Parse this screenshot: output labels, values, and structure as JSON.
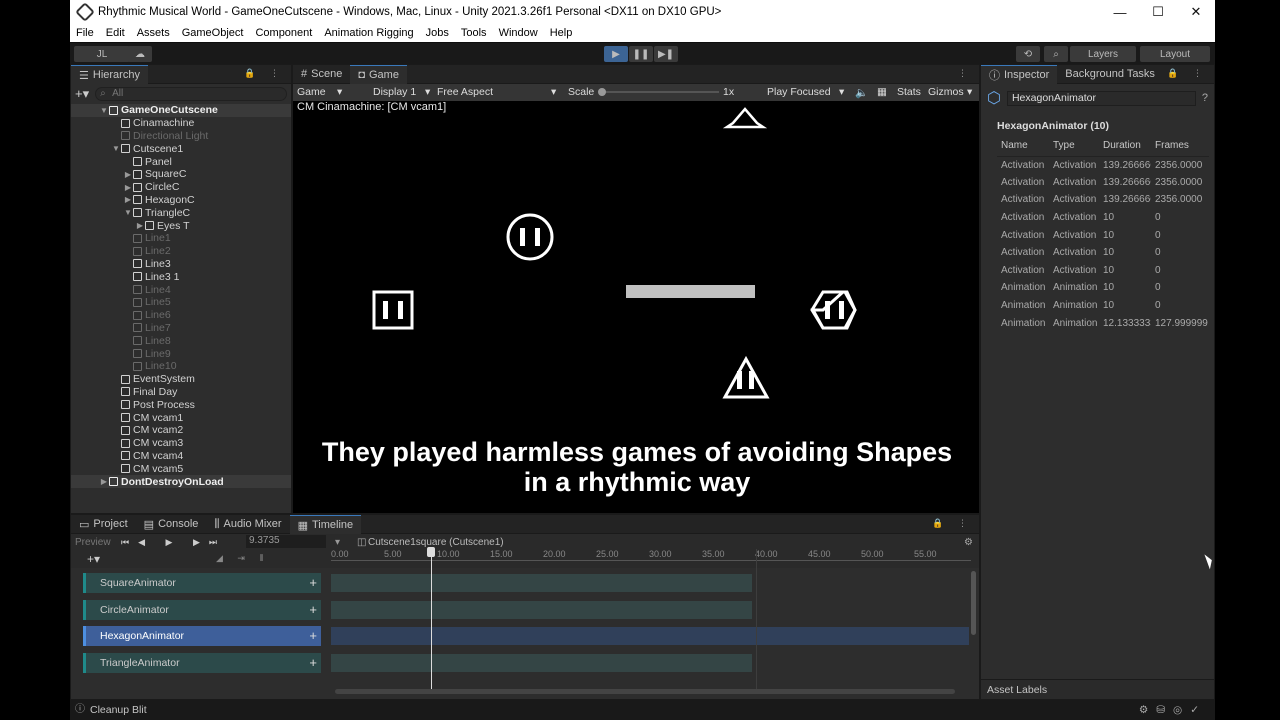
{
  "window": {
    "title": "Rhythmic Musical World - GameOneCutscene - Windows, Mac, Linux - Unity 2021.3.26f1 Personal <DX11 on DX10 GPU>",
    "minimize": "—",
    "maximize": "☐",
    "close": "✕"
  },
  "menu": [
    "File",
    "Edit",
    "Assets",
    "GameObject",
    "Component",
    "Animation Rigging",
    "Jobs",
    "Tools",
    "Window",
    "Help"
  ],
  "toolbar": {
    "account": "JL",
    "layers": "Layers",
    "layout": "Layout"
  },
  "hierarchy": {
    "tab": "Hierarchy",
    "search_placeholder": "All",
    "rows": [
      {
        "label": "GameOneCutscene",
        "depth": 0,
        "arrow": "▼",
        "scene": true
      },
      {
        "label": "Cinamachine",
        "depth": 1,
        "arrow": ""
      },
      {
        "label": "Directional Light",
        "depth": 1,
        "arrow": "",
        "dim": true
      },
      {
        "label": "Cutscene1",
        "depth": 1,
        "arrow": "▼"
      },
      {
        "label": "Panel",
        "depth": 2,
        "arrow": ""
      },
      {
        "label": "SquareC",
        "depth": 2,
        "arrow": "▶"
      },
      {
        "label": "CircleC",
        "depth": 2,
        "arrow": "▶"
      },
      {
        "label": "HexagonC",
        "depth": 2,
        "arrow": "▶"
      },
      {
        "label": "TriangleC",
        "depth": 2,
        "arrow": "▼"
      },
      {
        "label": "Eyes T",
        "depth": 3,
        "arrow": "▶"
      },
      {
        "label": "Line1",
        "depth": 2,
        "arrow": "",
        "dim": true
      },
      {
        "label": "Line2",
        "depth": 2,
        "arrow": "",
        "dim": true
      },
      {
        "label": "Line3",
        "depth": 2,
        "arrow": ""
      },
      {
        "label": "Line3 1",
        "depth": 2,
        "arrow": ""
      },
      {
        "label": "Line4",
        "depth": 2,
        "arrow": "",
        "dim": true
      },
      {
        "label": "Line5",
        "depth": 2,
        "arrow": "",
        "dim": true
      },
      {
        "label": "Line6",
        "depth": 2,
        "arrow": "",
        "dim": true
      },
      {
        "label": "Line7",
        "depth": 2,
        "arrow": "",
        "dim": true
      },
      {
        "label": "Line8",
        "depth": 2,
        "arrow": "",
        "dim": true
      },
      {
        "label": "Line9",
        "depth": 2,
        "arrow": "",
        "dim": true
      },
      {
        "label": "Line10",
        "depth": 2,
        "arrow": "",
        "dim": true
      },
      {
        "label": "EventSystem",
        "depth": 1,
        "arrow": ""
      },
      {
        "label": "Final Day",
        "depth": 1,
        "arrow": ""
      },
      {
        "label": "Post Process",
        "depth": 1,
        "arrow": ""
      },
      {
        "label": "CM vcam1",
        "depth": 1,
        "arrow": ""
      },
      {
        "label": "CM vcam2",
        "depth": 1,
        "arrow": ""
      },
      {
        "label": "CM vcam3",
        "depth": 1,
        "arrow": ""
      },
      {
        "label": "CM vcam4",
        "depth": 1,
        "arrow": ""
      },
      {
        "label": "CM vcam5",
        "depth": 1,
        "arrow": ""
      },
      {
        "label": "DontDestroyOnLoad",
        "depth": 0,
        "arrow": "▶",
        "scene": true
      }
    ]
  },
  "game": {
    "tabs": {
      "scene": "Scene",
      "game": "Game"
    },
    "mode": "Game",
    "display": "Display 1",
    "aspect": "Free Aspect",
    "scale_label": "Scale",
    "scale_value": "1x",
    "play_focused": "Play Focused",
    "stats": "Stats",
    "gizmos": "Gizmos",
    "camera_label": "CM Cinamachine: [CM vcam1]",
    "subtitle_line1": "They played harmless games of avoiding Shapes",
    "subtitle_line2": "in a rhythmic way"
  },
  "inspector": {
    "tabs": {
      "inspector": "Inspector",
      "background": "Background Tasks"
    },
    "object_name": "HexagonAnimator",
    "section_title": "HexagonAnimator (10)",
    "columns": [
      "Name",
      "Type",
      "Duration",
      "Frames"
    ],
    "rows": [
      [
        "Activation",
        "Activation",
        "139.266666",
        "2356.0000"
      ],
      [
        "Activation",
        "Activation",
        "139.266666",
        "2356.0000"
      ],
      [
        "Activation",
        "Activation",
        "139.266666",
        "2356.0000"
      ],
      [
        "Activation",
        "Activation",
        "10",
        "0"
      ],
      [
        "Activation",
        "Activation",
        "10",
        "0"
      ],
      [
        "Activation",
        "Activation",
        "10",
        "0"
      ],
      [
        "Activation",
        "Activation",
        "10",
        "0"
      ],
      [
        "Animation",
        "Animation",
        "10",
        "0"
      ],
      [
        "Animation",
        "Animation",
        "10",
        "0"
      ],
      [
        "Animation",
        "Animation",
        "12.1333333",
        "127.999999"
      ]
    ],
    "asset_labels": "Asset Labels"
  },
  "timeline": {
    "tabs": {
      "project": "Project",
      "console": "Console",
      "mixer": "Audio Mixer",
      "timeline": "Timeline"
    },
    "preview": "Preview",
    "time": "9.3735",
    "asset": "Cutscene1square (Cutscene1)",
    "ticks": [
      "0.00",
      "5.00",
      "10.00",
      "15.00",
      "20.00",
      "25.00",
      "30.00",
      "35.00",
      "40.00",
      "45.00",
      "50.00",
      "55.00"
    ],
    "tracks": [
      "SquareAnimator",
      "CircleAnimator",
      "HexagonAnimator",
      "TriangleAnimator"
    ]
  },
  "status": {
    "text": "Cleanup Blit"
  }
}
